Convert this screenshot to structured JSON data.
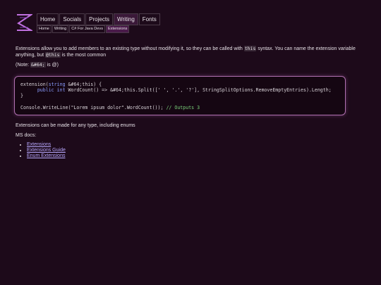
{
  "nav": {
    "items": [
      {
        "label": "Home",
        "active": false
      },
      {
        "label": "Socials",
        "active": false
      },
      {
        "label": "Projects",
        "active": false
      },
      {
        "label": "Writing",
        "active": true
      },
      {
        "label": "Fonts",
        "active": false
      }
    ]
  },
  "breadcrumb": {
    "items": [
      {
        "label": "Home"
      },
      {
        "label": "Writing"
      },
      {
        "label": "C# For Java Devs"
      },
      {
        "label": "Extensions"
      }
    ]
  },
  "content": {
    "intro_part1": "Extensions allow you to add members to an existing type without modifying it, so they can be called with ",
    "intro_code1": "this",
    "intro_part2": " syntax. You can name the extension variable anything, but ",
    "intro_code2": "@this",
    "intro_part3": " is the most common",
    "note_part1": "(Note: ",
    "note_code": "&#64;",
    "note_part2": " is @)",
    "code_lines": [
      "extension(string &#64;this) {",
      "      public int WordCount() => &#64;this.Split([' ', '.', '?'], StringSplitOptions.RemoveEmptyEntries).Length;",
      "}",
      "",
      "Console.WriteLine(\"Lorem ipsum dolor\".WordCount()); // Outputs 3"
    ],
    "types_text": "Extensions can be made for any type, including enums",
    "ms_docs_label": "MS docs:",
    "links": [
      {
        "label": "Extensions"
      },
      {
        "label": "Extensions Guide"
      },
      {
        "label": "Enum Extensions"
      }
    ]
  },
  "colors": {
    "background": "#1d0a1a",
    "accent": "#b070b0",
    "link": "#b8a8ff",
    "keyword": "#8a9cff",
    "comment": "#7ad07a"
  }
}
